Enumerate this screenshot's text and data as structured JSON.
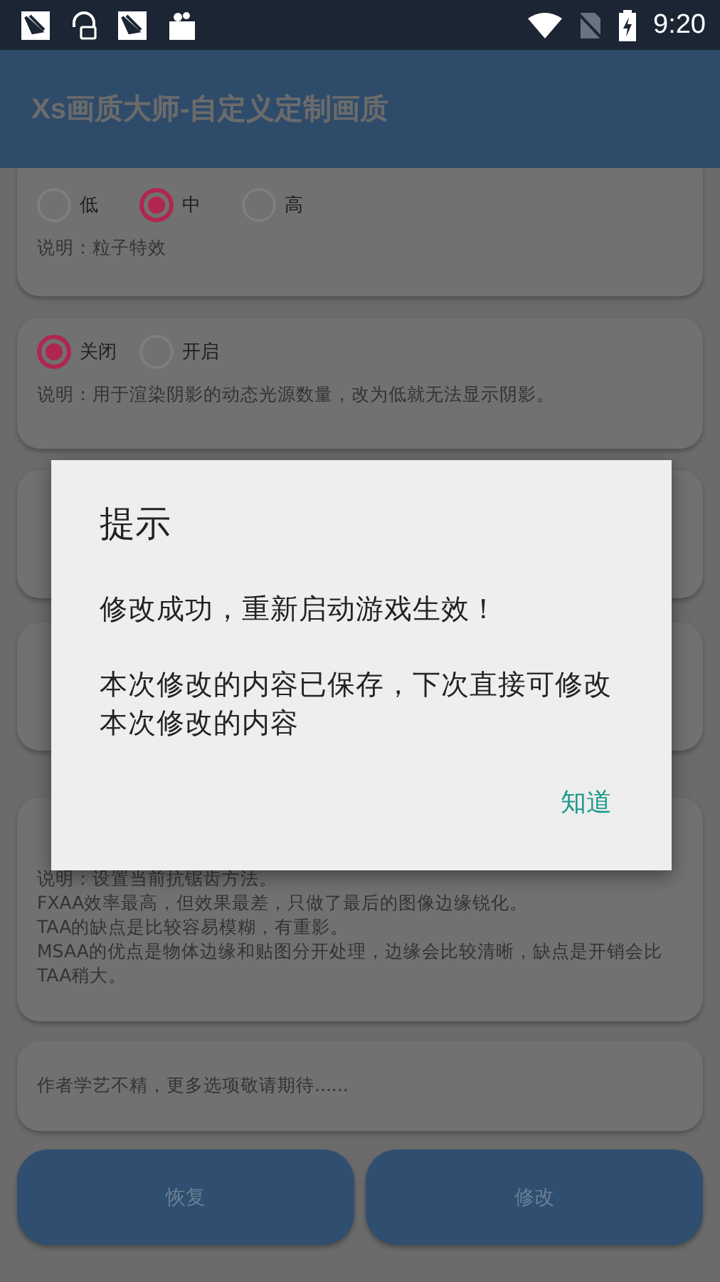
{
  "status_bar": {
    "time": "9:20"
  },
  "app_bar": {
    "title": "Xs画质大师-自定义定制画质"
  },
  "cards": [
    {
      "kind": "radio",
      "options": [
        {
          "label": "低",
          "selected": false
        },
        {
          "label": "中",
          "selected": true
        },
        {
          "label": "高",
          "selected": false
        }
      ],
      "description": "说明：粒子特效"
    },
    {
      "kind": "radio",
      "options": [
        {
          "label": "关闭",
          "selected": true
        },
        {
          "label": "开启",
          "selected": false
        }
      ],
      "description": "说明：用于渲染阴影的动态光源数量，改为低就无法显示阴影。"
    },
    {
      "kind": "covered"
    },
    {
      "kind": "covered"
    },
    {
      "kind": "notes",
      "lines": [
        "说明：设置当前抗锯齿方法。",
        "FXAA效率最高，但效果最差，只做了最后的图像边缘锐化。",
        "TAA的缺点是比较容易模糊，有重影。",
        "MSAA的优点是物体边缘和贴图分开处理，边缘会比较清晰，缺点是开销会比TAA稍大。"
      ]
    },
    {
      "kind": "note",
      "text": "作者学艺不精，更多选项敬请期待......"
    }
  ],
  "buttons": [
    {
      "label": "恢复"
    },
    {
      "label": "修改"
    }
  ],
  "dialog": {
    "title": "提示",
    "message": "修改成功，重新启动游戏生效！",
    "detail": "本次修改的内容已保存，下次直接可修改本次修改的内容",
    "action": "知道"
  }
}
